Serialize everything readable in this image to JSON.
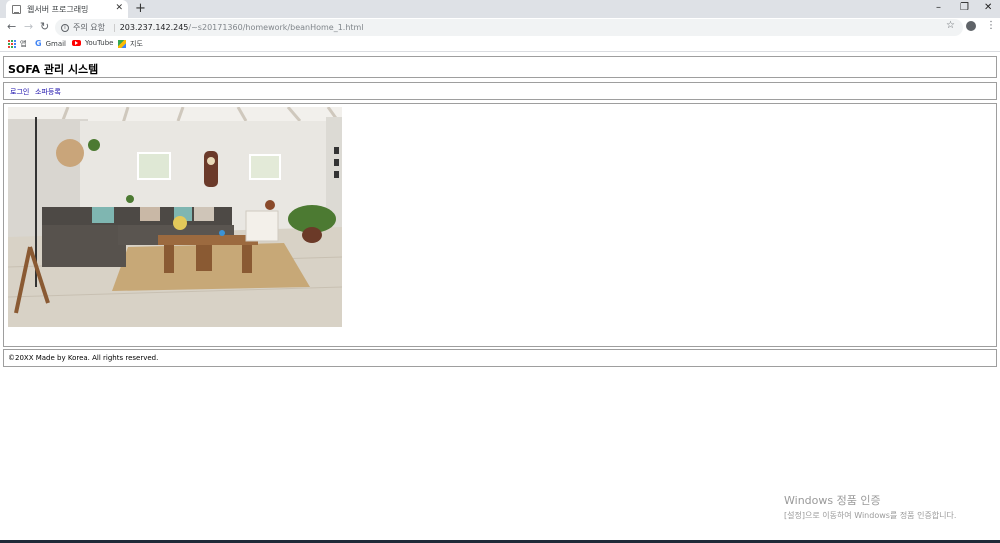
{
  "browser": {
    "tab_title": "웹서버 프로그래밍",
    "address": {
      "warning": "주의 요함",
      "host": "203.237.142.245",
      "path": "/~s20171360/homework/beanHome_1.html"
    },
    "bookmarks": [
      {
        "label": "앱",
        "icon": "apps-icon"
      },
      {
        "label": "Gmail",
        "icon": "google-icon"
      },
      {
        "label": "YouTube",
        "icon": "youtube-icon"
      },
      {
        "label": "지도",
        "icon": "maps-icon"
      }
    ]
  },
  "page": {
    "title": "SOFA 관리 시스템",
    "menu": [
      "로그인",
      "소파등록"
    ],
    "footer": "©20XX Made by Korea. All rights reserved."
  },
  "system": {
    "activation_title": "Windows 정품 인증",
    "activation_text": "[설정]으로 이동하여 Windows를 정품 인증합니다."
  }
}
